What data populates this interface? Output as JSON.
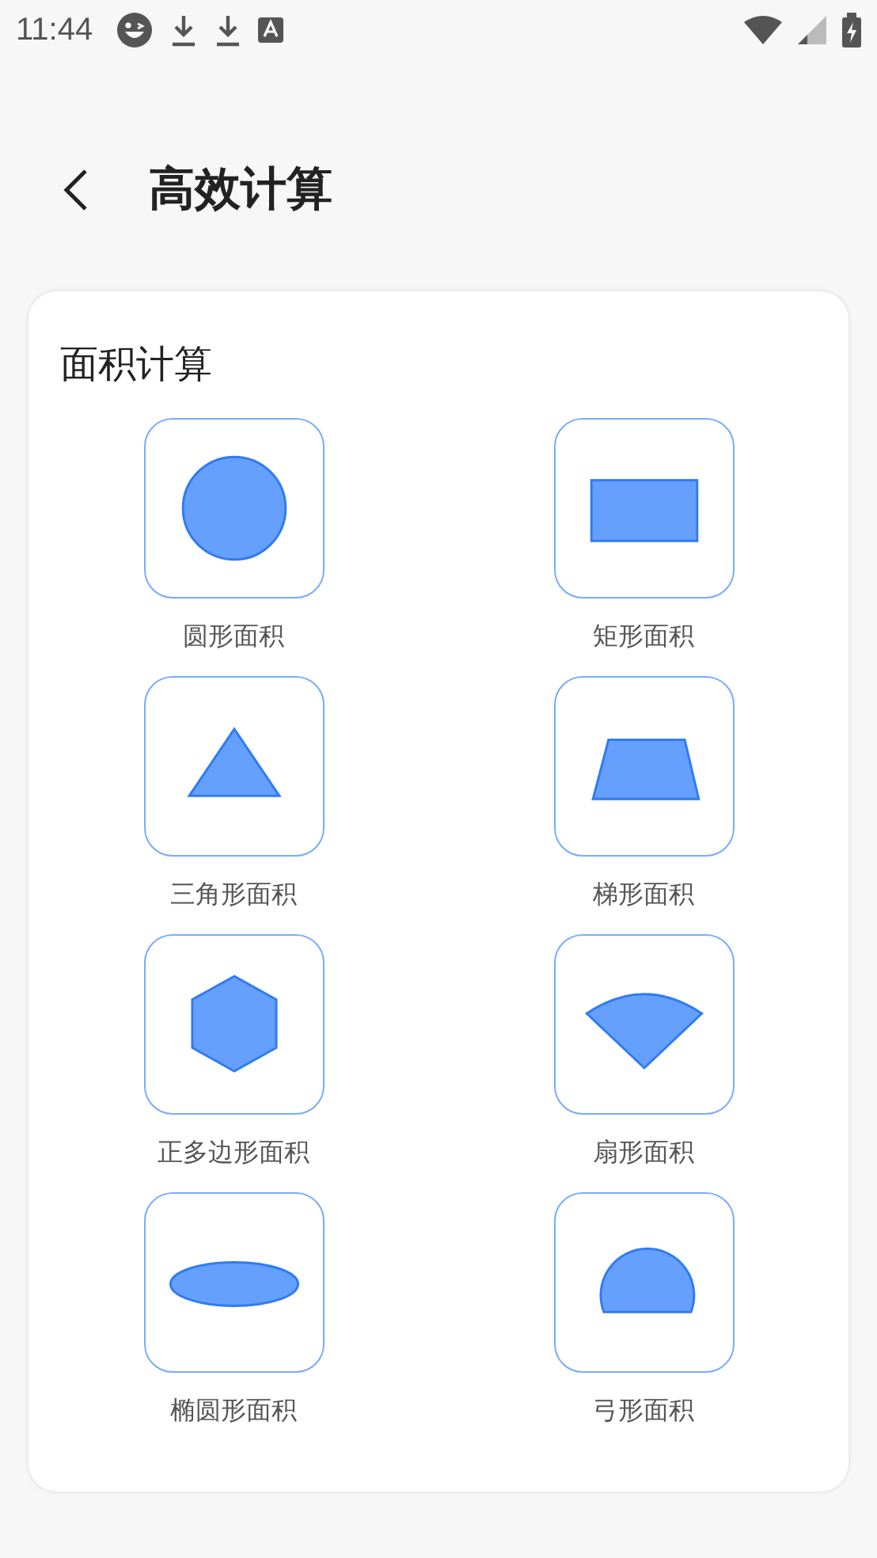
{
  "status_bar": {
    "time": "11:44"
  },
  "header": {
    "title": "高效计算"
  },
  "card": {
    "title": "面积计算",
    "items": [
      {
        "label": "圆形面积",
        "kind": "circle"
      },
      {
        "label": "矩形面积",
        "kind": "rectangle"
      },
      {
        "label": "三角形面积",
        "kind": "triangle"
      },
      {
        "label": "梯形面积",
        "kind": "trapezoid"
      },
      {
        "label": "正多边形面积",
        "kind": "hexagon"
      },
      {
        "label": "扇形面积",
        "kind": "sector"
      },
      {
        "label": "椭圆形面积",
        "kind": "ellipse"
      },
      {
        "label": "弓形面积",
        "kind": "segment"
      }
    ]
  }
}
